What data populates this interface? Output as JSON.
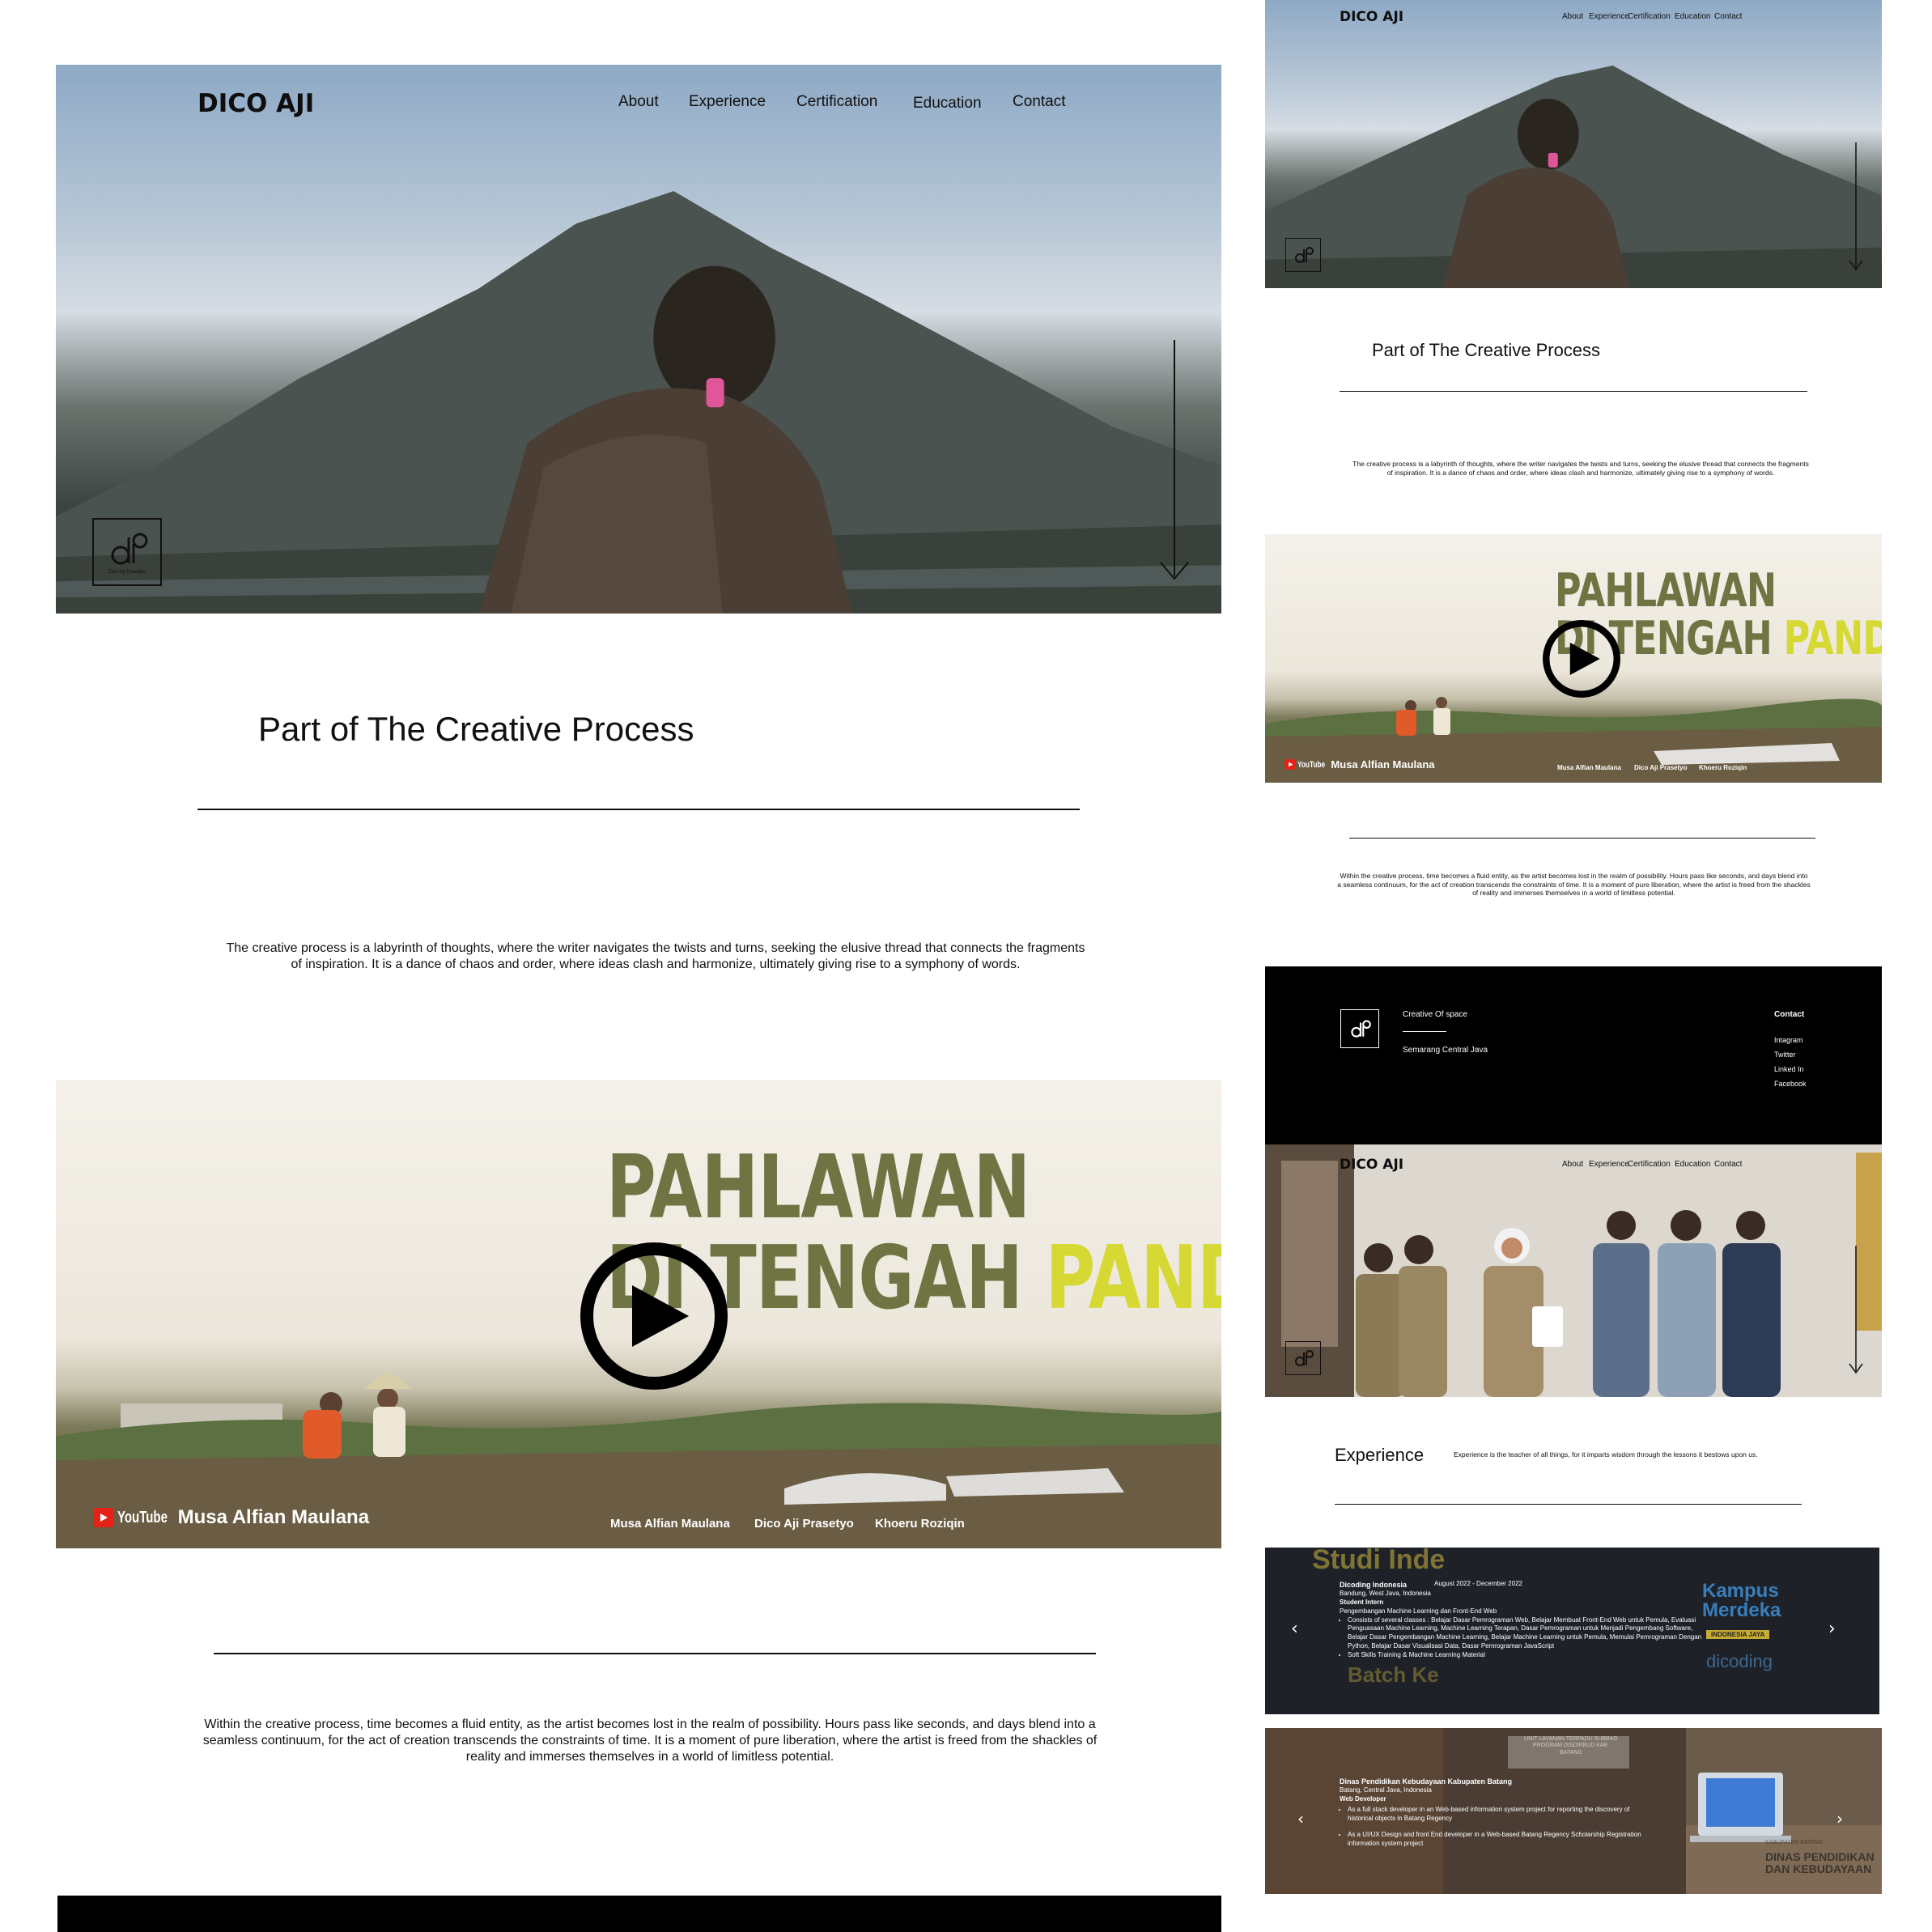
{
  "brand": "DICO AJI",
  "nav": [
    "About",
    "Experience",
    "Certification",
    "Education",
    "Contact"
  ],
  "logo_caption": "Dico Aji Prasetyo",
  "section1": {
    "title": "Part of The Creative Process",
    "text": "The creative process is a labyrinth of thoughts, where the writer navigates the twists and turns, seeking the elusive thread that connects the fragments of inspiration. It is a dance of chaos and order, where ideas clash and harmonize, ultimately giving rise to a symphony of words."
  },
  "video": {
    "title_line1": "PAHLAWAN",
    "title_line2_a": "DI TENGAH",
    "title_line2_b": "PANDEMI",
    "channel": "YouTube",
    "author": "Musa Alfian Maulana",
    "credits": [
      "Musa Alfian Maulana",
      "Dico Aji Prasetyo",
      "Khoeru Roziqin"
    ]
  },
  "section2": {
    "text": "Within the creative process, time becomes a fluid entity, as the artist becomes lost in the realm of possibility. Hours pass like seconds, and days blend into a seamless continuum, for the act of creation transcends the constraints of time. It is a moment of pure liberation, where the artist is freed from the shackles of reality and immerses themselves in a world of limitless potential."
  },
  "footer": {
    "tagline": "Creative Of space",
    "location": "Semarang Central Java",
    "contact_heading": "Contact",
    "links": [
      "Intagram",
      "Twitter",
      "Linked In",
      "Facebook"
    ]
  },
  "experience": {
    "heading": "Experience",
    "subtitle": "Experience is the teacher of all things, for it imparts wisdom through the lessons it bestows upon us.",
    "cards": [
      {
        "org": "Dicoding Indonesia",
        "period": "August 2022 - December 2022",
        "location": "Bandung, West Java, Indonesia",
        "role": "Student Intern",
        "track": "Pengembangan Machine Learning dan Front-End Web",
        "bullets": [
          "Consists of several classes : Belajar Dasar Pemrograman Web, Belajar Membuat Front-End Web untuk Pemula, Evaluasi Penguasaan Machine Learning, Machine Learning Terapan, Dasar Pemrograman untuk Menjadi Pengembang Software, Belajar Dasar Pengembangan Machine Learning, Belajar Machine Learning untuk Pemula, Memulai Pemrograman Dengan Python, Belajar Dasar Visualisasi Data, Dasar Pemrograman JavaScript",
          "Soft Skills Training & Machine Learning Material"
        ],
        "bg_text_1": "Studi Inde",
        "bg_text_2": "Batch Ke",
        "bg_text_3": "Kampus Merdeka",
        "bg_text_4": "INDONESIA JAYA",
        "bg_text_5": "dicoding"
      },
      {
        "org": "Dinas Pendidikan Kebudayaan Kabupaten Batang",
        "location": "Batang, Central Java, Indonesia",
        "role": "Web Developer",
        "bullets": [
          "As a full stack developer in an Web-based information system project for reporting the discovery of historical objects in Batang Regency",
          "As a UI/UX Design and front End developer in a Web-based Batang Regency Scholarship Registration information system project"
        ],
        "bg_text_1": "UNIT LAYANAN TERPADU SUBBAG PROGRAM DISDIKBUD KAB. BATANG",
        "bg_text_2": "DINAS PENDIDIKAN DAN KEBUDAYAAN",
        "bg_text_3": "KABUPATEN BATANG"
      }
    ]
  },
  "colors": {
    "olive": "#6f7443",
    "yellow": "#d6d834",
    "youtube_red": "#e62117"
  }
}
